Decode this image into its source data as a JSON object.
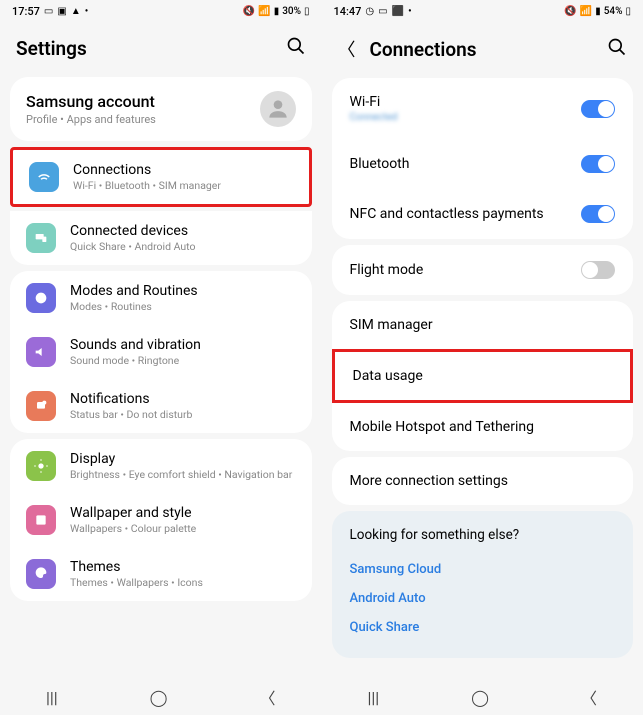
{
  "left": {
    "status": {
      "time": "17:57",
      "battery_pct": "30%"
    },
    "header": {
      "title": "Settings"
    },
    "account": {
      "title": "Samsung account",
      "sub": "Profile  •  Apps and features"
    },
    "items": [
      {
        "icon": "wifi",
        "color": "#4aa3df",
        "title": "Connections",
        "sub": "Wi-Fi  •  Bluetooth  •  SIM manager",
        "highlight": true
      },
      {
        "icon": "devices",
        "color": "#7ed0c0",
        "title": "Connected devices",
        "sub": "Quick Share  •  Android Auto"
      },
      {
        "icon": "modes",
        "color": "#6b6be0",
        "title": "Modes and Routines",
        "sub": "Modes  •  Routines"
      },
      {
        "icon": "sound",
        "color": "#9b6bd8",
        "title": "Sounds and vibration",
        "sub": "Sound mode  •  Ringtone"
      },
      {
        "icon": "notif",
        "color": "#e87a5a",
        "title": "Notifications",
        "sub": "Status bar  •  Do not disturb"
      },
      {
        "icon": "display",
        "color": "#8bc34a",
        "title": "Display",
        "sub": "Brightness  •  Eye comfort shield  •  Navigation bar"
      },
      {
        "icon": "wallpaper",
        "color": "#e06b9b",
        "title": "Wallpaper and style",
        "sub": "Wallpapers  •  Colour palette"
      },
      {
        "icon": "themes",
        "color": "#8b6bd8",
        "title": "Themes",
        "sub": "Themes  •  Wallpapers  •  Icons"
      }
    ]
  },
  "right": {
    "status": {
      "time": "14:47",
      "battery_pct": "54%"
    },
    "header": {
      "title": "Connections"
    },
    "group1": [
      {
        "label": "Wi-Fi",
        "sub": "Connected",
        "toggle": true
      },
      {
        "label": "Bluetooth",
        "toggle": true
      },
      {
        "label": "NFC and contactless payments",
        "toggle": true
      }
    ],
    "group2": [
      {
        "label": "Flight mode",
        "toggle": false
      }
    ],
    "group3": [
      {
        "label": "SIM manager"
      },
      {
        "label": "Data usage",
        "highlight": true
      },
      {
        "label": "Mobile Hotspot and Tethering"
      }
    ],
    "group4": [
      {
        "label": "More connection settings"
      }
    ],
    "help": {
      "title": "Looking for something else?",
      "links": [
        "Samsung Cloud",
        "Android Auto",
        "Quick Share"
      ]
    }
  }
}
